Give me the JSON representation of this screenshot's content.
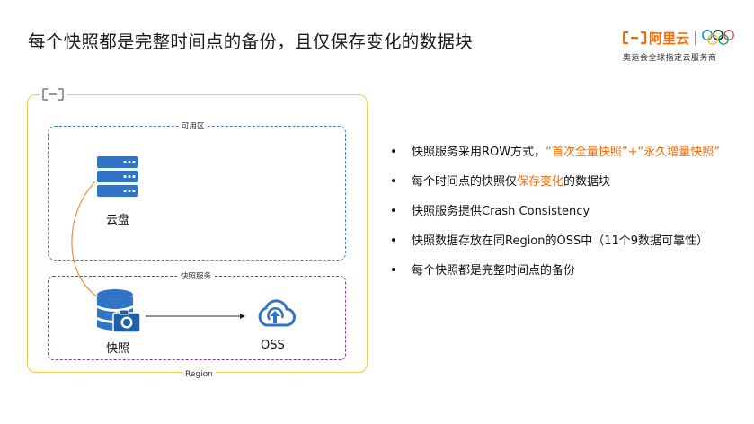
{
  "title": "每个快照都是完整时间点的备份，且仅保存变化的数据块",
  "brand": {
    "name": "阿里云",
    "subtitle": "奥运会全球指定云服务商",
    "colors": {
      "orange": "#ff6a00"
    }
  },
  "diagram": {
    "region_label": "Region",
    "az_label": "可用区",
    "snapshot_service_label": "快照服务",
    "nodes": {
      "disk": "云盘",
      "snapshot": "快照",
      "oss": "OSS"
    },
    "colors": {
      "region_border": "#f2c94c",
      "az_border": "#3f7fd6",
      "snapshot_border": "#8e3aa3",
      "icon_blue": "#2f74c5",
      "arrow_orange": "#f08a4b"
    }
  },
  "bullets": [
    {
      "pre": "快照服务采用ROW方式，",
      "hl": "“首次全量快照”+“永久增量快照”",
      "post": ""
    },
    {
      "pre": "每个时间点的快照仅",
      "hl": "保存变化",
      "post": "的数据块"
    },
    {
      "pre": "快照服务提供Crash Consistency",
      "hl": "",
      "post": ""
    },
    {
      "pre": "快照数据存放在同Region的OSS中（11个9数据可靠性）",
      "hl": "",
      "post": ""
    },
    {
      "pre": "每个快照都是完整时间点的备份",
      "hl": "",
      "post": ""
    }
  ]
}
